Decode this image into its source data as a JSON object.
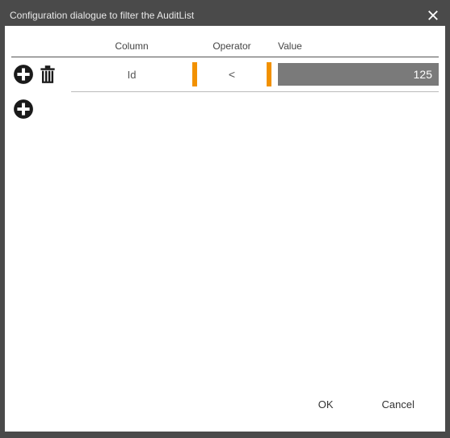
{
  "title": "Configuration dialogue to filter the AuditList",
  "headers": {
    "column": "Column",
    "operator": "Operator",
    "value": "Value"
  },
  "rows": [
    {
      "column": "Id",
      "operator": "<",
      "value": "125"
    }
  ],
  "footer": {
    "ok": "OK",
    "cancel": "Cancel"
  },
  "colors": {
    "accent": "#f29100",
    "chrome": "#4a4a4a",
    "input_bg": "#7a7a7a"
  }
}
